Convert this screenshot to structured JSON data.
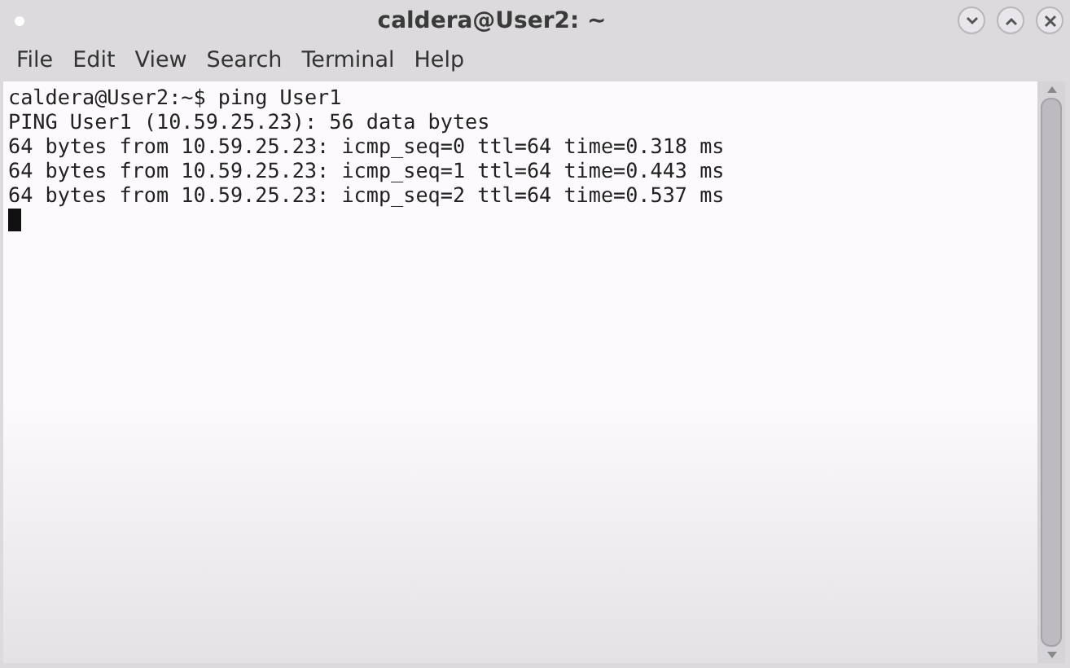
{
  "window": {
    "title": "caldera@User2: ~"
  },
  "menu": [
    "File",
    "Edit",
    "View",
    "Search",
    "Terminal",
    "Help"
  ],
  "terminal": {
    "lines": [
      "caldera@User2:~$ ping User1",
      "PING User1 (10.59.25.23): 56 data bytes",
      "64 bytes from 10.59.25.23: icmp_seq=0 ttl=64 time=0.318 ms",
      "64 bytes from 10.59.25.23: icmp_seq=1 ttl=64 time=0.443 ms",
      "64 bytes from 10.59.25.23: icmp_seq=2 ttl=64 time=0.537 ms"
    ]
  }
}
